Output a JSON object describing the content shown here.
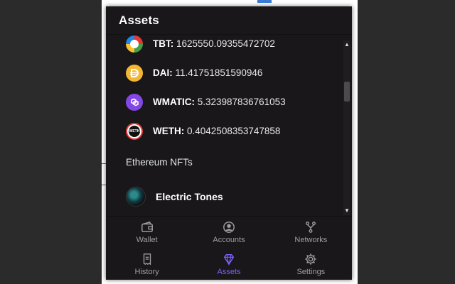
{
  "header": {
    "title": "Assets"
  },
  "tokens": [
    {
      "symbol": "TBT",
      "label": "TBT:",
      "value": "1625550.09355472702",
      "icon_color": "#f5a623"
    },
    {
      "symbol": "DAI",
      "label": "DAI:",
      "value": "11.41751851590946",
      "icon_color": "#f4b731"
    },
    {
      "symbol": "WMATIC",
      "label": "WMATIC:",
      "value": "5.323987836761053",
      "icon_color": "#8247e5"
    },
    {
      "symbol": "WETH",
      "label": "WETH:",
      "value": "0.4042508353747858",
      "icon_color": "#ffffff"
    }
  ],
  "nft_section": {
    "title": "Ethereum NFTs"
  },
  "nfts": [
    {
      "name": "Electric Tones"
    }
  ],
  "nav": {
    "wallet": "Wallet",
    "accounts": "Accounts",
    "networks": "Networks",
    "history": "History",
    "assets": "Assets",
    "settings": "Settings",
    "active": "assets"
  },
  "colors": {
    "accent": "#7b61ff",
    "background": "#19171a"
  }
}
